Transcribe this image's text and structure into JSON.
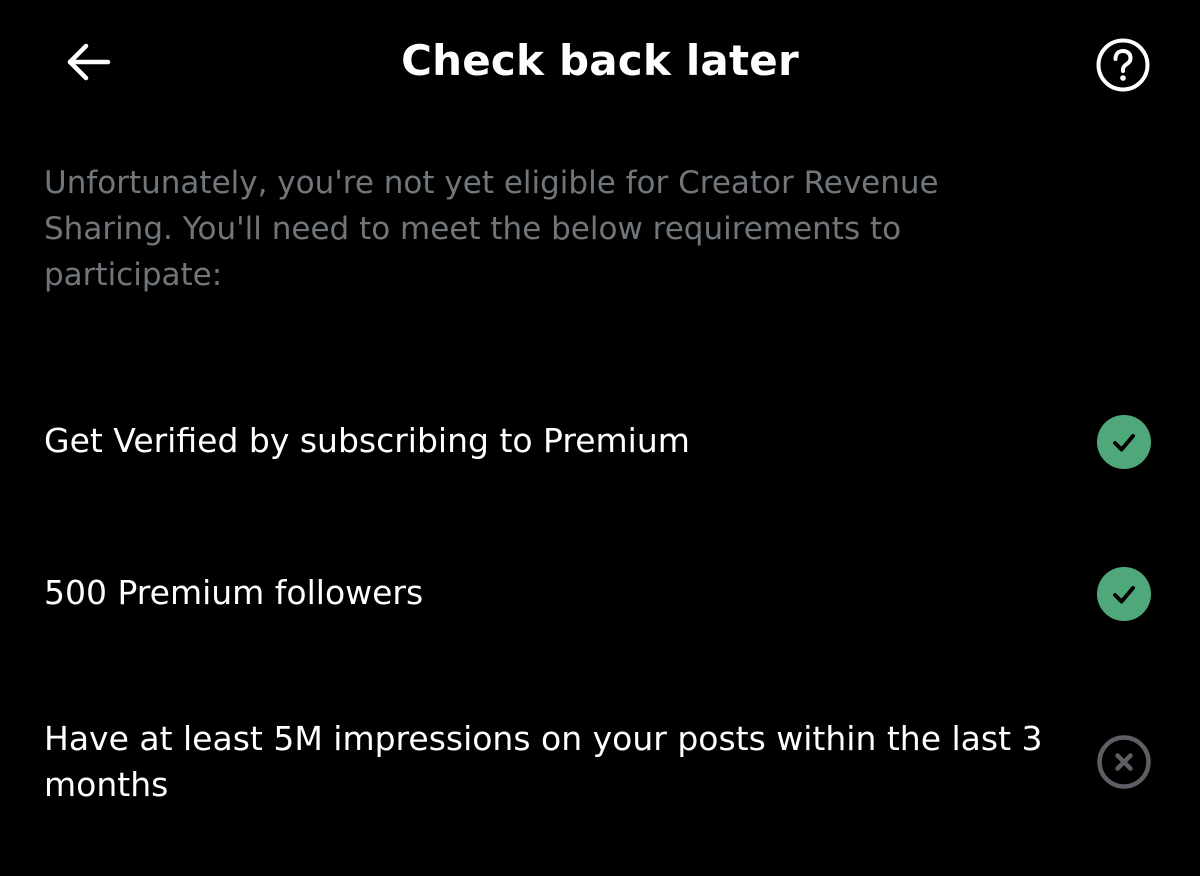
{
  "header": {
    "title": "Check back later",
    "back_icon": "arrow-left-icon",
    "help_icon": "question-circle-icon"
  },
  "description": "Unfortunately, you're not yet eligible for Creator Revenue Sharing. You'll need to meet the below requirements to participate:",
  "requirements": [
    {
      "label": "Get Verified by subscribing to Premium",
      "status": "met",
      "icon": "check-circle-icon"
    },
    {
      "label": "500 Premium followers",
      "status": "met",
      "icon": "check-circle-icon"
    },
    {
      "label": "Have at least 5M impressions on your posts within the last 3 months",
      "status": "not-met",
      "icon": "x-circle-icon"
    }
  ],
  "colors": {
    "background": "#000000",
    "text_primary": "#ffffff",
    "text_secondary": "#71767b",
    "success": "#4fa87a",
    "unmet": "#5b5f63"
  }
}
